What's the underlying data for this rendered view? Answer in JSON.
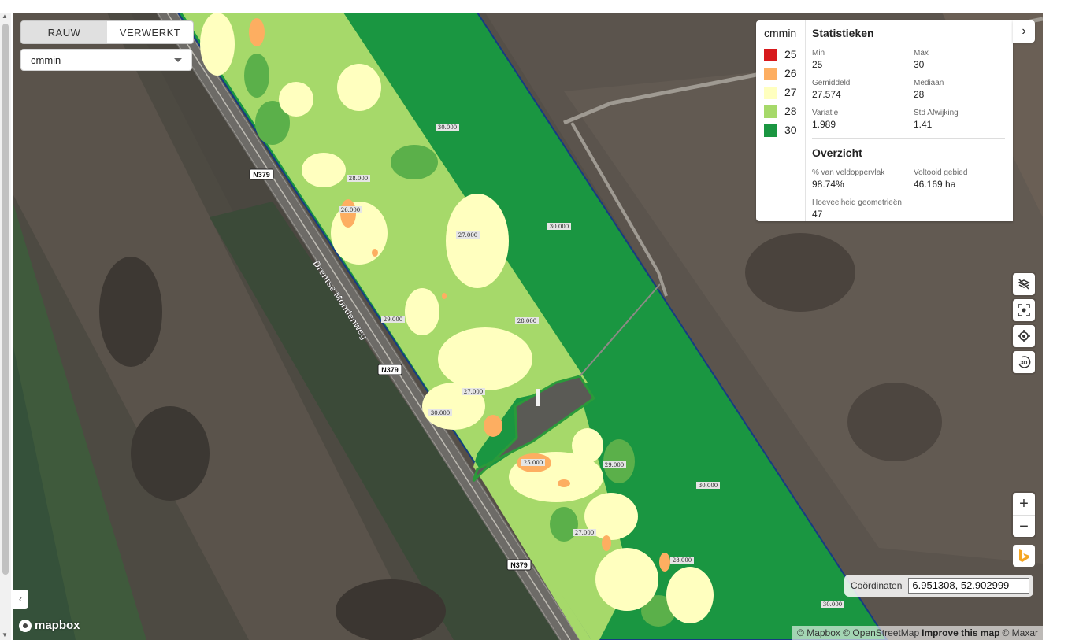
{
  "toggle": {
    "raw_label": "RAUW",
    "processed_label": "VERWERKT",
    "active": "RAUW"
  },
  "layer_select": {
    "value": "cmmin"
  },
  "legend": {
    "title": "cmmin",
    "items": [
      {
        "value": "25",
        "color": "#d7191c"
      },
      {
        "value": "26",
        "color": "#fdae61"
      },
      {
        "value": "27",
        "color": "#ffffbf"
      },
      {
        "value": "28",
        "color": "#a6d96a"
      },
      {
        "value": "30",
        "color": "#1a9641"
      }
    ]
  },
  "stats": {
    "title": "Statistieken",
    "min": {
      "label": "Min",
      "value": "25"
    },
    "max": {
      "label": "Max",
      "value": "30"
    },
    "mean": {
      "label": "Gemiddeld",
      "value": "27.574"
    },
    "median": {
      "label": "Mediaan",
      "value": "28"
    },
    "variance": {
      "label": "Variatie",
      "value": "1.989"
    },
    "stddev": {
      "label": "Std Afwijking",
      "value": "1.41"
    }
  },
  "overview": {
    "title": "Overzicht",
    "pct": {
      "label": "% van veldoppervlak",
      "value": "98.74%"
    },
    "area": {
      "label": "Voltooid gebied",
      "value": "46.169 ha"
    },
    "count": {
      "label": "Hoeveelheid geometrieën",
      "value": "47"
    }
  },
  "map": {
    "road_name": "Drentse Mondenweg",
    "road_shield": "N379",
    "zone_labels": [
      "30.000",
      "28.000",
      "26.000",
      "27.000",
      "30.000",
      "29.000",
      "28.000",
      "27.000",
      "30.000",
      "25.000",
      "29.000",
      "30.000",
      "27.000",
      "28.000",
      "30.000"
    ]
  },
  "coordinates": {
    "label": "Coördinaten",
    "value": "6.951308, 52.902999"
  },
  "attribution": {
    "mapbox": "© Mapbox",
    "osm": "© OpenStreetMap",
    "improve": "Improve this map",
    "maxar": "© Maxar"
  },
  "logo": {
    "text": "mapbox"
  },
  "icons": {
    "panel_toggle": "chevron-right-icon",
    "hide_layer": "layer-off-icon",
    "fit": "fit-bounds-icon",
    "locate": "locate-icon",
    "rotate3d": "rotate-3d-icon",
    "bing": "bing-icon",
    "collapse": "chevron-left-icon"
  }
}
